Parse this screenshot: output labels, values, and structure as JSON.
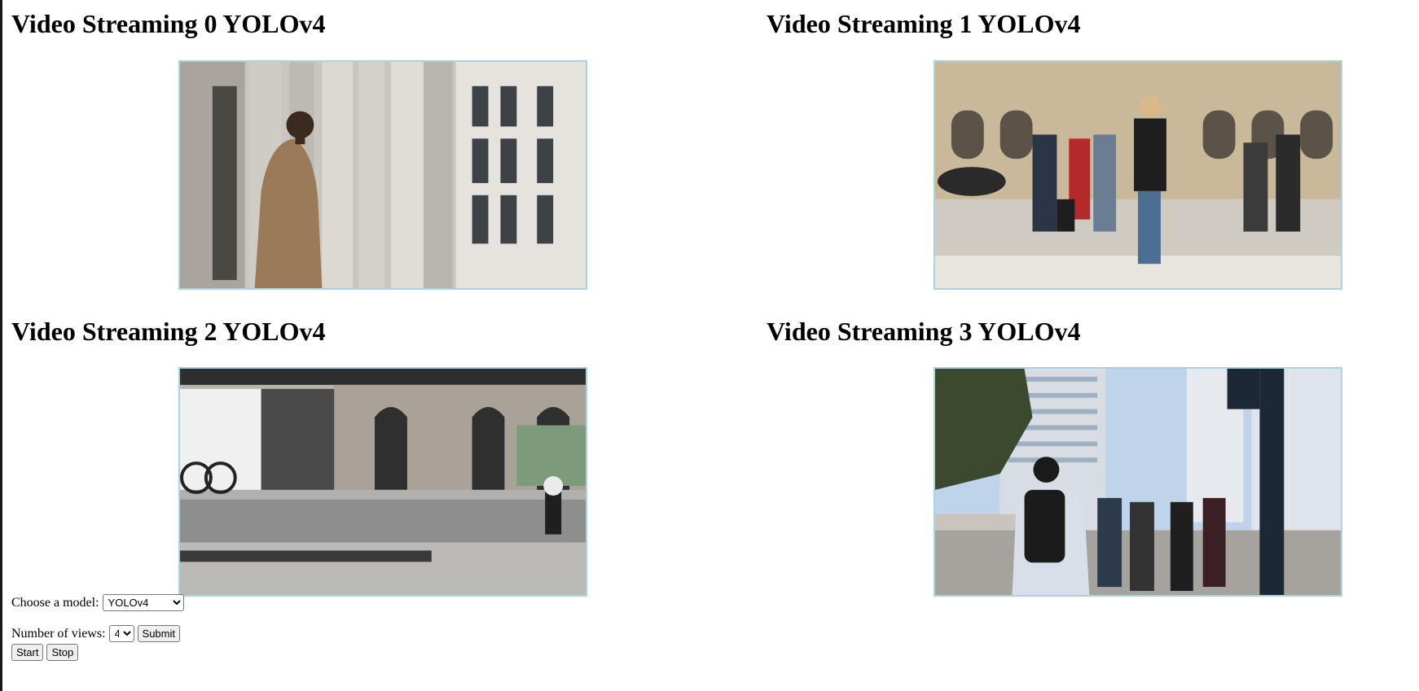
{
  "streams": [
    {
      "title": "Video Streaming 0 YOLOv4",
      "scene": "man-in-coat-with-columns"
    },
    {
      "title": "Video Streaming 1 YOLOv4",
      "scene": "people-waiting-at-crosswalk"
    },
    {
      "title": "Video Streaming 2 YOLOv4",
      "scene": "city-street-with-truck-and-cyclist"
    },
    {
      "title": "Video Streaming 3 YOLOv4",
      "scene": "pedestrians-near-skyscrapers"
    }
  ],
  "controls": {
    "model_label": "Choose a model:",
    "model_selected": "YOLOv4",
    "views_label": "Number of views:",
    "views_selected": "4",
    "submit_label": "Submit",
    "start_label": "Start",
    "stop_label": "Stop"
  }
}
